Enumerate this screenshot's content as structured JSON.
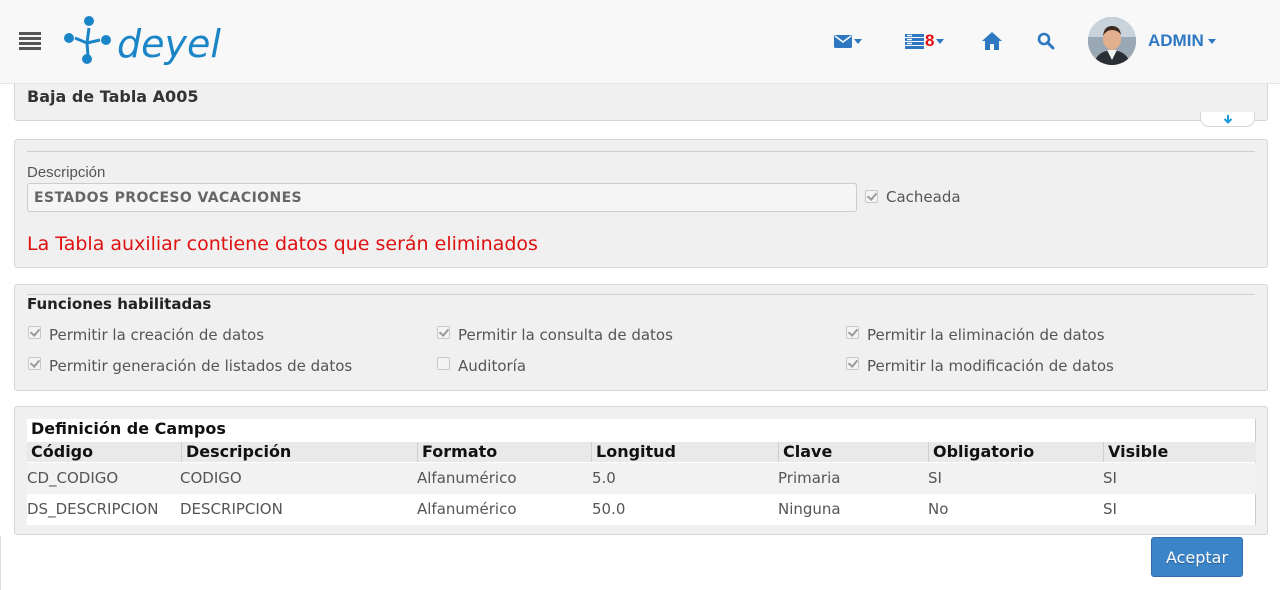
{
  "header": {
    "logo_text": "deyel",
    "tasks_badge": "8",
    "user_name": "ADMIN"
  },
  "page": {
    "title": "Baja de Tabla A005"
  },
  "description_section": {
    "label": "Descripción",
    "value": "ESTADOS PROCESO VACACIONES",
    "cached_label": "Cacheada",
    "cached_checked": true,
    "warning": "La Tabla auxiliar contiene datos que serán eliminados"
  },
  "functions_section": {
    "title": "Funciones habilitadas",
    "items": [
      {
        "label": "Permitir la creación de datos",
        "checked": true
      },
      {
        "label": "Permitir la consulta de datos",
        "checked": true
      },
      {
        "label": "Permitir la eliminación de datos",
        "checked": true
      },
      {
        "label": "Permitir generación de listados de datos",
        "checked": true
      },
      {
        "label": "Auditoría",
        "checked": false
      },
      {
        "label": "Permitir la modificación de datos",
        "checked": true
      }
    ]
  },
  "fields_section": {
    "title": "Definición de Campos",
    "columns": [
      "Código",
      "Descripción",
      "Formato",
      "Longitud",
      "Clave",
      "Obligatorio",
      "Visible"
    ],
    "rows": [
      [
        "CD_CODIGO",
        "CODIGO",
        "Alfanumérico",
        "5.0",
        "Primaria",
        "SI",
        "SI"
      ],
      [
        "DS_DESCRIPCION",
        "DESCRIPCION",
        "Alfanumérico",
        "50.0",
        "Ninguna",
        "No",
        "SI"
      ]
    ]
  },
  "actions": {
    "accept_label": "Aceptar"
  },
  "colors": {
    "accent": "#2e78c2",
    "warning": "#e01010",
    "button": "#3b84c8"
  },
  "icons": [
    "menu-icon",
    "mail-icon",
    "tasks-icon",
    "home-icon",
    "search-icon",
    "arrow-down-icon"
  ]
}
